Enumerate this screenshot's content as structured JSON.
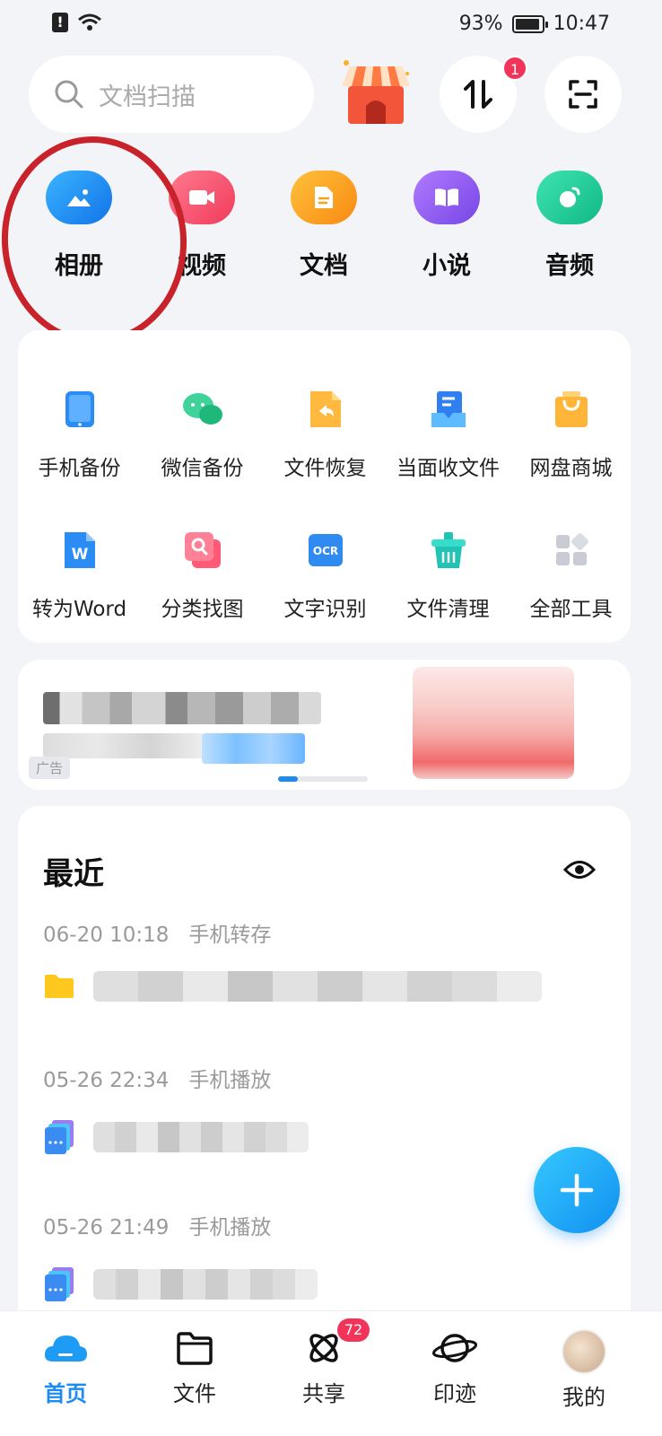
{
  "status_bar": {
    "battery": "93%",
    "time": "10:47"
  },
  "search": {
    "placeholder": "文档扫描"
  },
  "header": {
    "transfer_badge": "1"
  },
  "quick_access": [
    {
      "label": "相册",
      "icon": "photo-album-icon",
      "color": "#1e8bf0"
    },
    {
      "label": "视频",
      "icon": "video-icon",
      "color": "#f2476a"
    },
    {
      "label": "文档",
      "icon": "document-icon",
      "color": "#f7a21b"
    },
    {
      "label": "小说",
      "icon": "book-icon",
      "color": "#8f5cf0"
    },
    {
      "label": "音频",
      "icon": "music-icon",
      "color": "#1fcf9a"
    }
  ],
  "tools": [
    {
      "label": "手机备份",
      "icon": "phone-backup-icon"
    },
    {
      "label": "微信备份",
      "icon": "wechat-backup-icon"
    },
    {
      "label": "文件恢复",
      "icon": "file-restore-icon"
    },
    {
      "label": "当面收文件",
      "icon": "receive-file-icon"
    },
    {
      "label": "网盘商城",
      "icon": "shop-bag-icon"
    },
    {
      "label": "转为Word",
      "icon": "word-convert-icon"
    },
    {
      "label": "分类找图",
      "icon": "image-search-icon"
    },
    {
      "label": "文字识别",
      "icon": "ocr-icon"
    },
    {
      "label": "文件清理",
      "icon": "file-clean-icon"
    },
    {
      "label": "全部工具",
      "icon": "all-tools-icon"
    }
  ],
  "ad": {
    "tag": "广告"
  },
  "recent": {
    "title": "最近",
    "groups": [
      {
        "time": "06-20 10:18",
        "source": "手机转存"
      },
      {
        "time": "05-26 22:34",
        "source": "手机播放"
      },
      {
        "time": "05-26 21:49",
        "source": "手机播放"
      }
    ]
  },
  "nav": {
    "items": [
      {
        "label": "首页",
        "icon": "home-cloud-icon",
        "active": true
      },
      {
        "label": "文件",
        "icon": "folder-icon"
      },
      {
        "label": "共享",
        "icon": "share-icon",
        "badge": "72"
      },
      {
        "label": "印迹",
        "icon": "planet-icon"
      },
      {
        "label": "我的",
        "icon": "avatar-icon"
      }
    ]
  }
}
